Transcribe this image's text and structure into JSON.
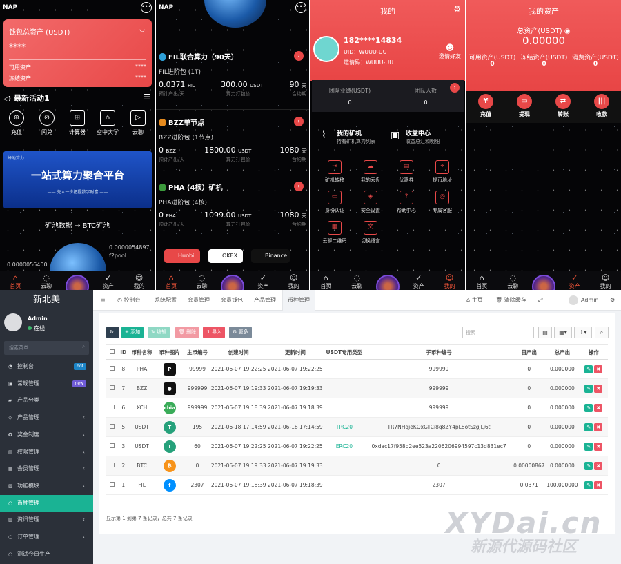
{
  "screen1": {
    "brand": "NAP",
    "wallet_title": "钱包总资产 (USDT)",
    "wallet_value": "****",
    "available_label": "可用资产",
    "available_value": "****",
    "frozen_label": "冻结资产",
    "frozen_value": "****",
    "news": "最新活动1",
    "quick": [
      {
        "label": "充值",
        "icon": "recharge-icon"
      },
      {
        "label": "闪兑",
        "icon": "swap-icon"
      },
      {
        "label": "计算器",
        "icon": "calculator-icon"
      },
      {
        "label": "空中大学",
        "icon": "school-icon"
      },
      {
        "label": "云聊",
        "icon": "video-icon"
      }
    ],
    "banner_small": "蜂池算力",
    "banner_title": "一站式算力聚合平台",
    "banner_sub": "—— 先人一步把握数字财富 ——",
    "pool_title": "矿池数据 → BTC矿池",
    "num_left": "0.0000056400",
    "num_right": "0.0000054897",
    "pool_name": "f2pool"
  },
  "screen2": {
    "brand": "NAP",
    "sections": [
      {
        "title": "FIL联合算力（90天）",
        "package": "FIL进阶包 (1T)",
        "v1": "0.0371",
        "u1": "FIL",
        "v2": "300.00",
        "u2": "USDT",
        "v3": "90",
        "u3": "天",
        "l1": "预计产出/天",
        "l2": "算力打包价",
        "l3": "合约期"
      },
      {
        "title": "BZZ单节点",
        "package": "BZZ进阶包 (1节点)",
        "v1": "0",
        "u1": "BZZ",
        "v2": "1800.00",
        "u2": "USDT",
        "v3": "1080",
        "u3": "天",
        "l1": "预计产出/天",
        "l2": "算力打包价",
        "l3": "合约期"
      },
      {
        "title": "PHA (4核）矿机",
        "package": "PHA进阶包 (4核)",
        "v1": "0",
        "u1": "PHA",
        "v2": "1099.00",
        "u2": "USDT",
        "v3": "1080",
        "u3": "天",
        "l1": "预计产出/天",
        "l2": "算力打包价",
        "l3": "合约期"
      }
    ],
    "exchanges": [
      "Huobi",
      "OKEX",
      "Binance"
    ]
  },
  "screen3": {
    "title": "我的",
    "phone": "182****14834",
    "uid": "UID：WUUU-UU",
    "invite": "邀请码：WUUU-UU",
    "invite_friend": "邀请好友",
    "team_perf_label": "团队业绩(USDT)",
    "team_perf": "0",
    "team_count_label": "团队人数",
    "team_count": "0",
    "miner_title": "我的矿机",
    "miner_sub": "持有矿机算力列表",
    "income_title": "收益中心",
    "income_sub": "收益总汇和明细",
    "grid": [
      "矿机转移",
      "我的云盘",
      "优惠券",
      "提币地址",
      "身份认证",
      "安全设置",
      "帮助中心",
      "专属客服",
      "云聊二维码",
      "切换语言"
    ]
  },
  "screen4": {
    "title": "我的资产",
    "total_label": "总资产(USDT)",
    "total": "0.00000",
    "available_label": "可用资产(USDT)",
    "available": "0",
    "frozen_label": "冻结资产(USDT)",
    "frozen": "0",
    "consume_label": "消费资产(USDT)",
    "consume": "0",
    "actions": [
      {
        "label": "充值",
        "icon": "¥"
      },
      {
        "label": "提现",
        "icon": "▭"
      },
      {
        "label": "转账",
        "icon": "⇄"
      },
      {
        "label": "收款",
        "icon": "|||"
      }
    ]
  },
  "tabs": [
    "首页",
    "云聊",
    "",
    "资产",
    "我的"
  ],
  "admin": {
    "logo": "新北美",
    "user": "Admin",
    "status": "在线",
    "search_placeholder": "搜索菜单",
    "menu": [
      {
        "label": "控制台",
        "badge": "hot",
        "badge_color": "#1c84c6"
      },
      {
        "label": "常规管理",
        "badge": "new",
        "badge_color": "#6f5bd6"
      },
      {
        "label": "产品分类"
      },
      {
        "label": "产品管理",
        "chev": "‹"
      },
      {
        "label": "奖金制度",
        "chev": "‹"
      },
      {
        "label": "权限管理",
        "chev": "‹"
      },
      {
        "label": "会员管理",
        "chev": "‹"
      },
      {
        "label": "功能模块",
        "chev": "‹"
      },
      {
        "label": "币种管理",
        "active": true
      },
      {
        "label": "资讯管理",
        "chev": "‹"
      },
      {
        "label": "订单管理",
        "chev": "‹"
      },
      {
        "label": "测试今日生产"
      }
    ],
    "topnav": [
      "≡",
      "控制台",
      "系统配置",
      "会员管理",
      "会员钱包",
      "产品管理",
      "币种管理"
    ],
    "home": "主页",
    "clear": "清除缓存",
    "admin_name": "Admin",
    "buttons": {
      "add": "添加",
      "edit": "编辑",
      "del": "删除",
      "import": "导入",
      "more": "更多"
    },
    "search_placeholder2": "搜索",
    "columns": [
      "",
      "ID",
      "币种名称",
      "币种图片",
      "主币编号",
      "创建时间",
      "更新时间",
      "USDT专用类型",
      "子币种编号",
      "日产出",
      "总产出",
      "操作"
    ],
    "rows": [
      {
        "id": "8",
        "name": "PHA",
        "code": "99999",
        "created": "2021-06-07 19:22:25",
        "updated": "2021-06-07 19:22:25",
        "type": "",
        "sub": "999999",
        "daily": "0",
        "total": "0.000000",
        "logo": "P",
        "color": "#111"
      },
      {
        "id": "7",
        "name": "BZZ",
        "code": "999999",
        "created": "2021-06-07 19:19:33",
        "updated": "2021-06-07 19:19:33",
        "type": "",
        "sub": "999999",
        "daily": "0",
        "total": "0.000000",
        "logo": "●",
        "color": "#111"
      },
      {
        "id": "6",
        "name": "XCH",
        "code": "999999",
        "created": "2021-06-07 19:18:39",
        "updated": "2021-06-07 19:18:39",
        "type": "",
        "sub": "999999",
        "daily": "0",
        "total": "0.000000",
        "logo": "chia",
        "color": "#3aac59"
      },
      {
        "id": "5",
        "name": "USDT",
        "code": "195",
        "created": "2021-06-18 17:14:59",
        "updated": "2021-06-18 17:14:59",
        "type": "TRC20",
        "sub": "TR7NHqjeKQxGTCi8q8ZY4pL8otSzgjLj6t",
        "daily": "0",
        "total": "0.000000",
        "logo": "T",
        "color": "#26a17b"
      },
      {
        "id": "3",
        "name": "USDT",
        "code": "60",
        "created": "2021-06-07 19:22:25",
        "updated": "2021-06-07 19:22:25",
        "type": "ERC20",
        "sub": "0xdac17f958d2ee523a2206206994597c13d831ec7",
        "daily": "0",
        "total": "0.000000",
        "logo": "T",
        "color": "#26a17b"
      },
      {
        "id": "2",
        "name": "BTC",
        "code": "0",
        "created": "2021-06-07 19:19:33",
        "updated": "2021-06-07 19:19:33",
        "type": "",
        "sub": "0",
        "daily": "0.00000867",
        "total": "0.000000",
        "logo": "₿",
        "color": "#f7931a"
      },
      {
        "id": "1",
        "name": "FIL",
        "code": "2307",
        "created": "2021-06-07 19:18:39",
        "updated": "2021-06-07 19:18:39",
        "type": "",
        "sub": "2307",
        "daily": "0.0371",
        "total": "100.000000",
        "logo": "f",
        "color": "#0090ff"
      }
    ],
    "footer": "显示第 1 到第 7 条记录，总共 7 条记录"
  },
  "watermark": {
    "main": "XYDai.cn",
    "sub": "新源代源码社区"
  }
}
